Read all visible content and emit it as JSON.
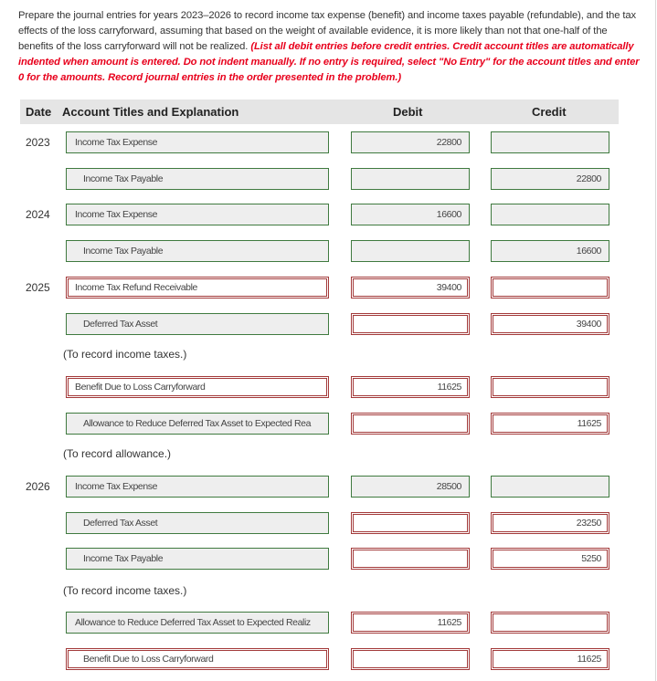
{
  "instructions": {
    "text": "Prepare the journal entries for years 2023–2026 to record income tax expense (benefit) and income taxes payable (refundable), and the tax effects of the loss carryforward, assuming that based on the weight of available evidence, it is more likely than not that one-half of the benefits of the loss carryforward will not be realized. ",
    "note": "(List all debit entries before credit entries. Credit account titles are automatically indented when amount is entered. Do not indent manually. If no entry is required, select \"No Entry\" for the account titles and enter 0 for the amounts. Record journal entries in the order presented in the problem.)"
  },
  "table_header": {
    "date": "Date",
    "account": "Account Titles and Explanation",
    "debit": "Debit",
    "credit": "Credit"
  },
  "rows": [
    {
      "year": "2023",
      "account": "Income Tax Expense",
      "debit": "22800",
      "credit": "",
      "acct_state": "green",
      "debit_state": "green",
      "credit_state": "green",
      "indent": false
    },
    {
      "year": "",
      "account": "Income Tax Payable",
      "debit": "",
      "credit": "22800",
      "acct_state": "green",
      "debit_state": "green",
      "credit_state": "green",
      "indent": true
    },
    {
      "year": "2024",
      "account": "Income Tax Expense",
      "debit": "16600",
      "credit": "",
      "acct_state": "green",
      "debit_state": "green",
      "credit_state": "green",
      "indent": false
    },
    {
      "year": "",
      "account": "Income Tax Payable",
      "debit": "",
      "credit": "16600",
      "acct_state": "green",
      "debit_state": "green",
      "credit_state": "green",
      "indent": true
    },
    {
      "year": "2025",
      "account": "Income Tax Refund Receivable",
      "debit": "39400",
      "credit": "",
      "acct_state": "red",
      "debit_state": "red",
      "credit_state": "red",
      "indent": false
    },
    {
      "year": "",
      "account": "Deferred Tax Asset",
      "debit": "",
      "credit": "39400",
      "acct_state": "green",
      "debit_state": "red",
      "credit_state": "red",
      "indent": true
    },
    {
      "year": "",
      "account": "Benefit Due to Loss Carryforward",
      "debit": "11625",
      "credit": "",
      "acct_state": "red",
      "debit_state": "red",
      "credit_state": "red",
      "indent": false
    },
    {
      "year": "",
      "account": "Allowance to Reduce Deferred Tax Asset to Expected Rea",
      "debit": "",
      "credit": "11625",
      "acct_state": "green",
      "debit_state": "red",
      "credit_state": "red",
      "indent": true
    },
    {
      "year": "2026",
      "account": "Income Tax Expense",
      "debit": "28500",
      "credit": "",
      "acct_state": "green",
      "debit_state": "green",
      "credit_state": "green",
      "indent": false
    },
    {
      "year": "",
      "account": "Deferred Tax Asset",
      "debit": "",
      "credit": "23250",
      "acct_state": "green",
      "debit_state": "red",
      "credit_state": "red",
      "indent": true
    },
    {
      "year": "",
      "account": "Income Tax Payable",
      "debit": "",
      "credit": "5250",
      "acct_state": "green",
      "debit_state": "red",
      "credit_state": "red",
      "indent": true
    },
    {
      "year": "",
      "account": "Allowance to Reduce Deferred Tax Asset to Expected Realiz",
      "debit": "11625",
      "credit": "",
      "acct_state": "green",
      "debit_state": "red",
      "credit_state": "red",
      "indent": false
    },
    {
      "year": "",
      "account": "Benefit Due to Loss Carryforward",
      "debit": "",
      "credit": "11625",
      "acct_state": "red",
      "debit_state": "red",
      "credit_state": "red",
      "indent": true
    }
  ],
  "explanations": [
    "(To record income taxes.)",
    "(To record allowance.)",
    "(To record income taxes.)"
  ],
  "colors": {
    "correct_border": "#3f7a3f",
    "incorrect_border": "#a33a3a",
    "note_red": "#e8001c",
    "header_bg": "#e5e5e5"
  }
}
